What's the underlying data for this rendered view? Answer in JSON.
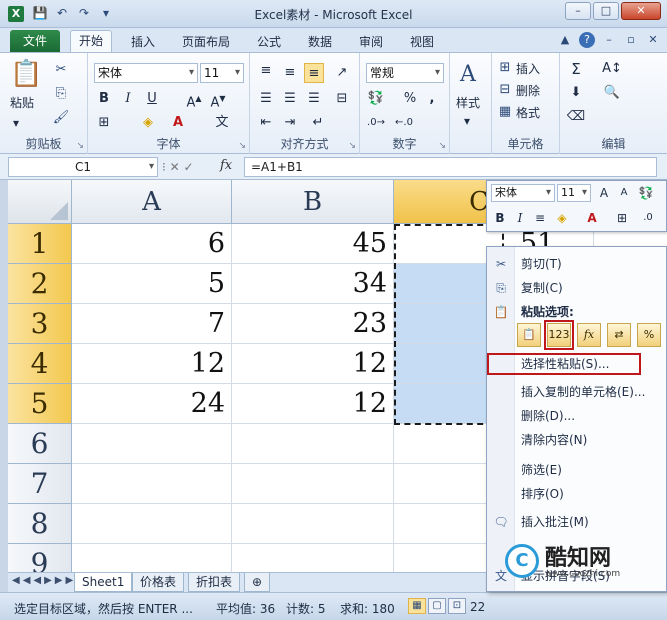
{
  "window": {
    "title": "Excel素材 - Microsoft Excel",
    "app_icon": "X"
  },
  "tabs": {
    "file": "文件",
    "items": [
      "开始",
      "插入",
      "页面布局",
      "公式",
      "数据",
      "审阅",
      "视图"
    ],
    "active": "开始"
  },
  "ribbon": {
    "clipboard": {
      "label": "剪贴板",
      "paste": "粘贴"
    },
    "font": {
      "label": "字体",
      "name": "宋体",
      "size": "11",
      "bold": "B",
      "italic": "I",
      "underline": "U",
      "wen": "文"
    },
    "alignment": {
      "label": "对齐方式"
    },
    "number": {
      "label": "数字",
      "format": "常规",
      "percent": "%",
      "comma": ","
    },
    "styles": {
      "label": "样式"
    },
    "cells": {
      "label": "单元格",
      "insert": "插入",
      "delete": "删除",
      "format": "格式"
    },
    "editing": {
      "label": "编辑"
    }
  },
  "formula_bar": {
    "name_box": "C1",
    "fx": "fx",
    "formula": "=A1+B1"
  },
  "sheet": {
    "columns": [
      "A",
      "B",
      "C"
    ],
    "rows": [
      "1",
      "2",
      "3",
      "4",
      "5",
      "6",
      "7",
      "8",
      "9"
    ],
    "values_a": [
      "6",
      "5",
      "7",
      "12",
      "24"
    ],
    "values_b": [
      "45",
      "34",
      "23",
      "12",
      "12"
    ],
    "partial_c1": "51"
  },
  "sheet_tabs": [
    "Sheet1",
    "价格表",
    "折扣表"
  ],
  "status": {
    "message": "选定目标区域，然后按 ENTER ...",
    "average": "平均值: 36",
    "count": "计数: 5",
    "sum": "求和: 180",
    "zoom": "22"
  },
  "mini_toolbar": {
    "font": "宋体",
    "size": "11",
    "bold": "B",
    "italic": "I"
  },
  "context_menu": {
    "cut": "剪切(T)",
    "copy": "复制(C)",
    "paste_options": "粘贴选项:",
    "paste_special": "选择性粘贴(S)...",
    "insert_copied": "插入复制的单元格(E)...",
    "delete": "删除(D)...",
    "clear": "清除内容(N)",
    "filter": "筛选(E)",
    "sort": "排序(O)",
    "insert_comment": "插入批注(M)",
    "phonetic": "显示拼音字段(S)",
    "paste_icons": [
      "📋",
      "123",
      "fx",
      "⇄",
      "%"
    ]
  },
  "watermark": {
    "text": "酷知网",
    "url": "www.coozhi.com"
  },
  "colors": {
    "accent": "#1b6a34",
    "selection": "#c5dcf4",
    "header_sel": "#f3c84f",
    "highlight": "#c0171b"
  }
}
